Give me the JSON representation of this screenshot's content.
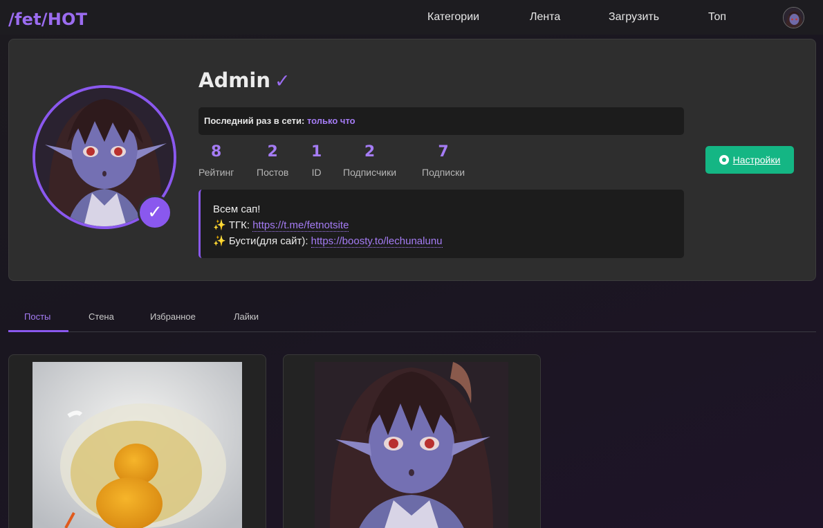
{
  "header": {
    "logo": "/fet/HOT",
    "nav": [
      "Категории",
      "Лента",
      "Загрузить",
      "Топ"
    ]
  },
  "profile": {
    "username": "Admin",
    "verified_mark": "✓",
    "badge_mark": "✓",
    "last_seen_label": "Последний раз в сети:",
    "last_seen_value": "только что",
    "stats": [
      {
        "value": "8",
        "label": "Рейтинг"
      },
      {
        "value": "2",
        "label": "Постов"
      },
      {
        "value": "1",
        "label": "ID"
      },
      {
        "value": "2",
        "label": "Подписчики"
      },
      {
        "value": "7",
        "label": "Подписки"
      }
    ],
    "bio": {
      "line1": "Всем сап!",
      "line2_prefix": "✨ ТГК: ",
      "line2_link": "https://t.me/fetnotsite",
      "line3_prefix": "✨ Бусти(для сайт): ",
      "line3_link": "https://boosty.to/lechunalunu"
    },
    "settings_label": "Настройки"
  },
  "tabs": [
    "Посты",
    "Стена",
    "Избранное",
    "Лайки"
  ],
  "active_tab": "Посты",
  "colors": {
    "accent": "#8a58ee",
    "accent_text": "#a57cf5",
    "settings_button": "#14b684"
  },
  "icons": {
    "verified": "check-icon",
    "settings": "gear-icon"
  }
}
